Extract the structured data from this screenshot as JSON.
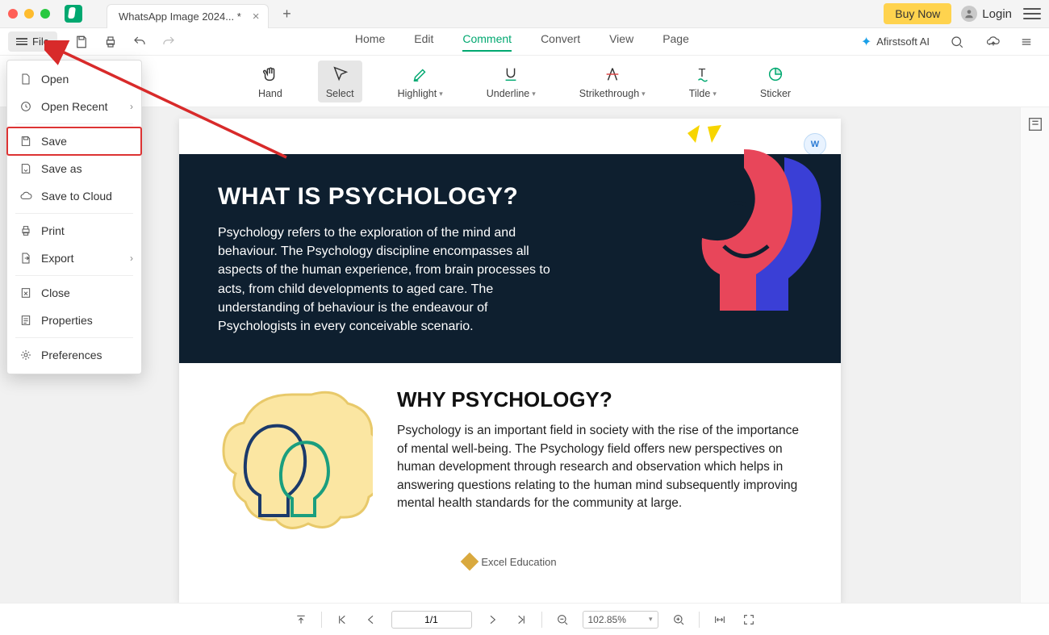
{
  "titlebar": {
    "tab_title": "WhatsApp Image 2024... *",
    "buy_label": "Buy Now",
    "login_label": "Login"
  },
  "menu": {
    "file_label": "File",
    "tabs": [
      "Home",
      "Edit",
      "Comment",
      "Convert",
      "View",
      "Page"
    ],
    "active_tab": "Comment",
    "ai_label": "Afirstsoft AI"
  },
  "toolbar": {
    "items": [
      {
        "id": "hand",
        "label": "Hand"
      },
      {
        "id": "select",
        "label": "Select"
      },
      {
        "id": "highlight",
        "label": "Highlight",
        "caret": true
      },
      {
        "id": "underline",
        "label": "Underline",
        "caret": true
      },
      {
        "id": "strike",
        "label": "Strikethrough",
        "caret": true
      },
      {
        "id": "tilde",
        "label": "Tilde",
        "caret": true
      },
      {
        "id": "sticker",
        "label": "Sticker"
      }
    ]
  },
  "file_menu": {
    "open": "Open",
    "open_recent": "Open Recent",
    "save": "Save",
    "save_as": "Save as",
    "save_cloud": "Save to Cloud",
    "print": "Print",
    "export": "Export",
    "close": "Close",
    "properties": "Properties",
    "preferences": "Preferences"
  },
  "doc": {
    "h1": "WHAT IS PSYCHOLOGY?",
    "p1": "Psychology refers to the exploration of the mind and behaviour. The Psychology discipline encompasses all aspects of the human experience, from brain processes to acts, from child developments to aged care. The understanding of behaviour is the endeavour of Psychologists in every conceivable scenario.",
    "h2": "WHY PSYCHOLOGY?",
    "p2": "Psychology is an important field in society with the rise of the importance of mental well-being. The Psychology field offers new perspectives on human development through research and observation which helps in answering questions relating to the human mind subsequently improving mental health standards for the community at large.",
    "footer": "Excel Education"
  },
  "status": {
    "page": "1/1",
    "zoom": "102.85%"
  }
}
